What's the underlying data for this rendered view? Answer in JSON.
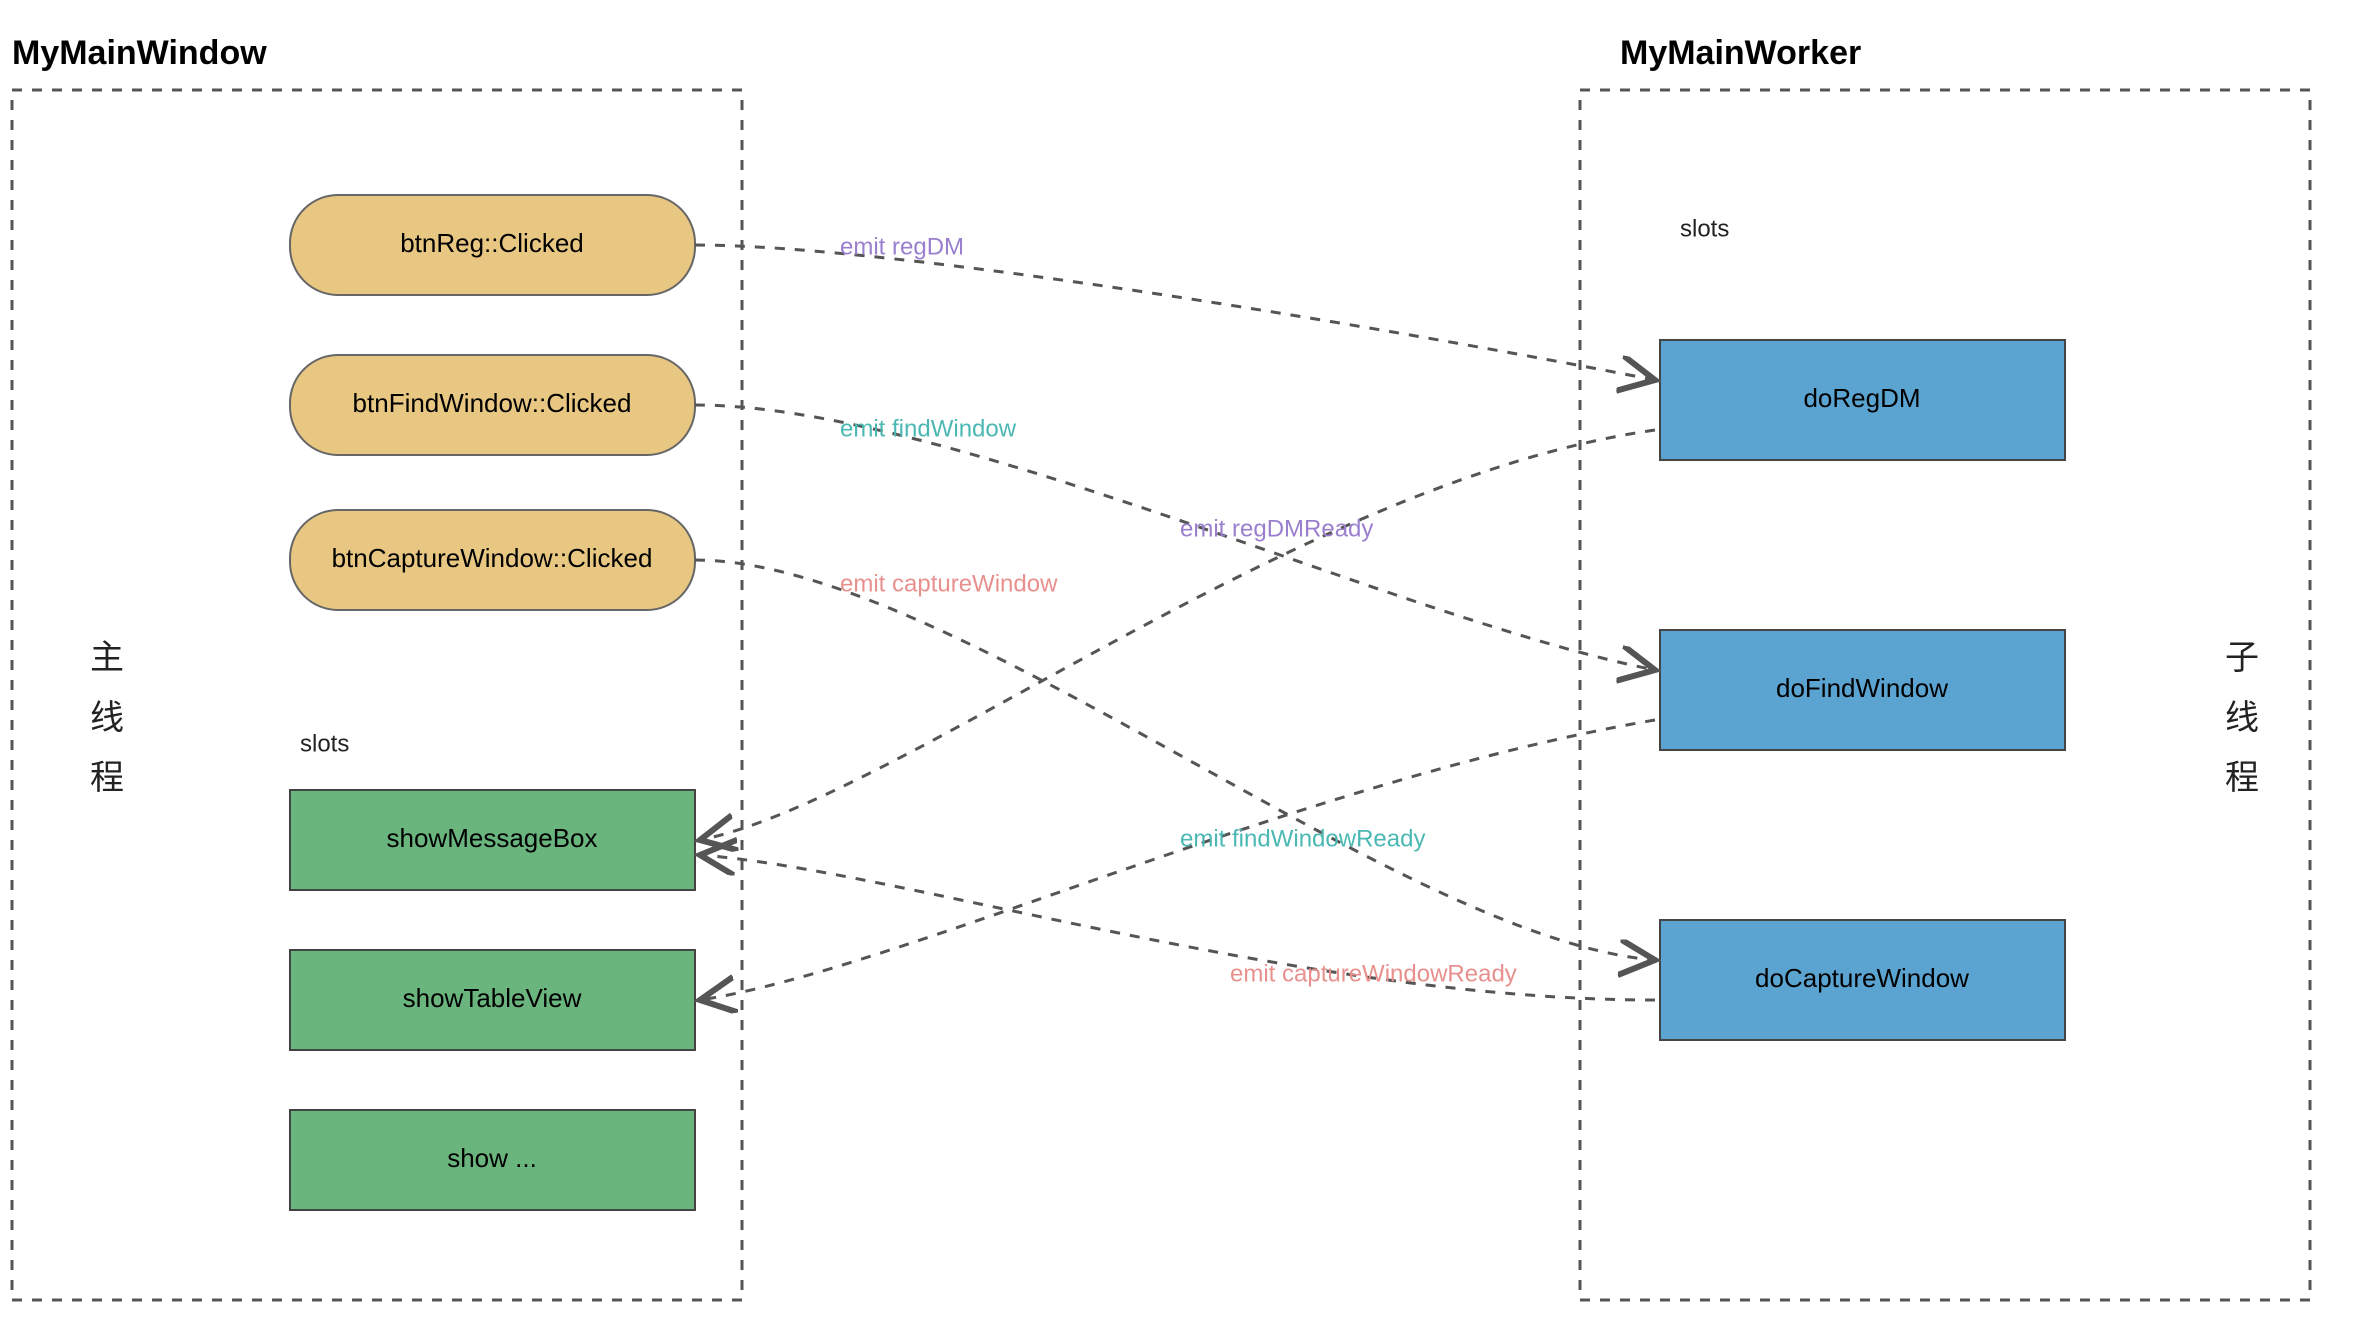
{
  "left": {
    "title": "MyMainWindow",
    "cn_label": "主线程",
    "buttons": {
      "reg": "btnReg::Clicked",
      "find": "btnFindWindow::Clicked",
      "capture": "btnCaptureWindow::Clicked"
    },
    "slots_label": "slots",
    "slots": {
      "msgbox": "showMessageBox",
      "table": "showTableView",
      "more": "show ..."
    }
  },
  "right": {
    "title": "MyMainWorker",
    "cn_label": "子线程",
    "slots_label": "slots",
    "slots": {
      "regdm": "doRegDM",
      "findwin": "doFindWindow",
      "capturewin": "doCaptureWindow"
    }
  },
  "emits": {
    "regdm": "emit regDM",
    "findwindow": "emit findWindow",
    "capturewindow": "emit captureWindow",
    "regdmready": "emit regDMReady",
    "findwindowready": "emit findWindowReady",
    "capturewindowready": "emit captureWindowReady"
  }
}
